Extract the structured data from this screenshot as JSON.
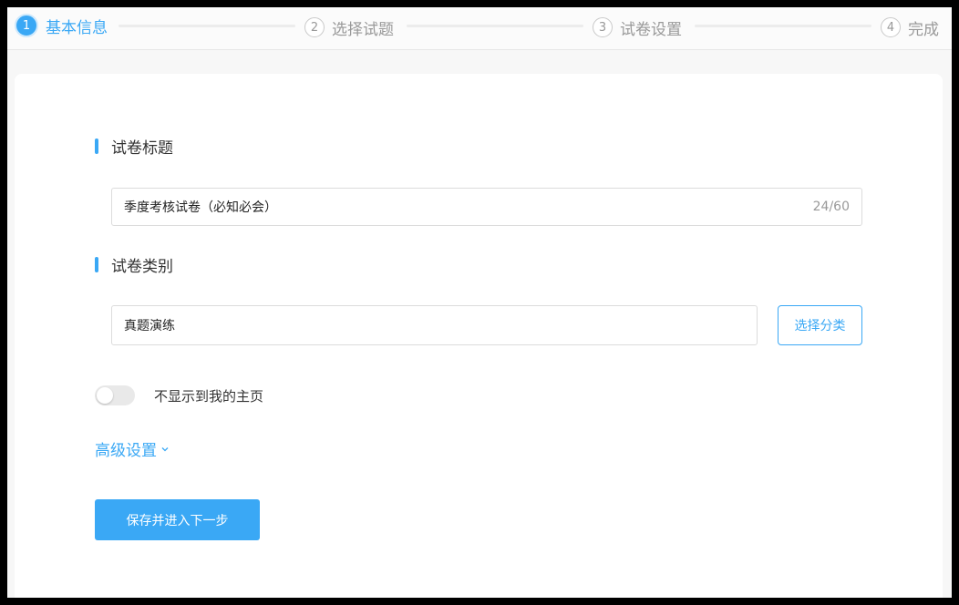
{
  "stepper": {
    "steps": [
      {
        "number": "1",
        "label": "基本信息"
      },
      {
        "number": "2",
        "label": "选择试题"
      },
      {
        "number": "3",
        "label": "试卷设置"
      },
      {
        "number": "4",
        "label": "完成"
      }
    ],
    "active_step": 1
  },
  "form": {
    "title_section": {
      "label": "试卷标题",
      "value": "季度考核试卷（必知必会）",
      "counter": "24/60"
    },
    "category_section": {
      "label": "试卷类别",
      "value": "真题演练",
      "select_button": "选择分类"
    },
    "hide_toggle": {
      "label": "不显示到我的主页",
      "on": false
    },
    "advanced_settings": "高级设置",
    "submit_button": "保存并进入下一步"
  },
  "colors": {
    "accent": "#3aa8f5",
    "muted": "#999999",
    "border": "#dcdcdc"
  }
}
